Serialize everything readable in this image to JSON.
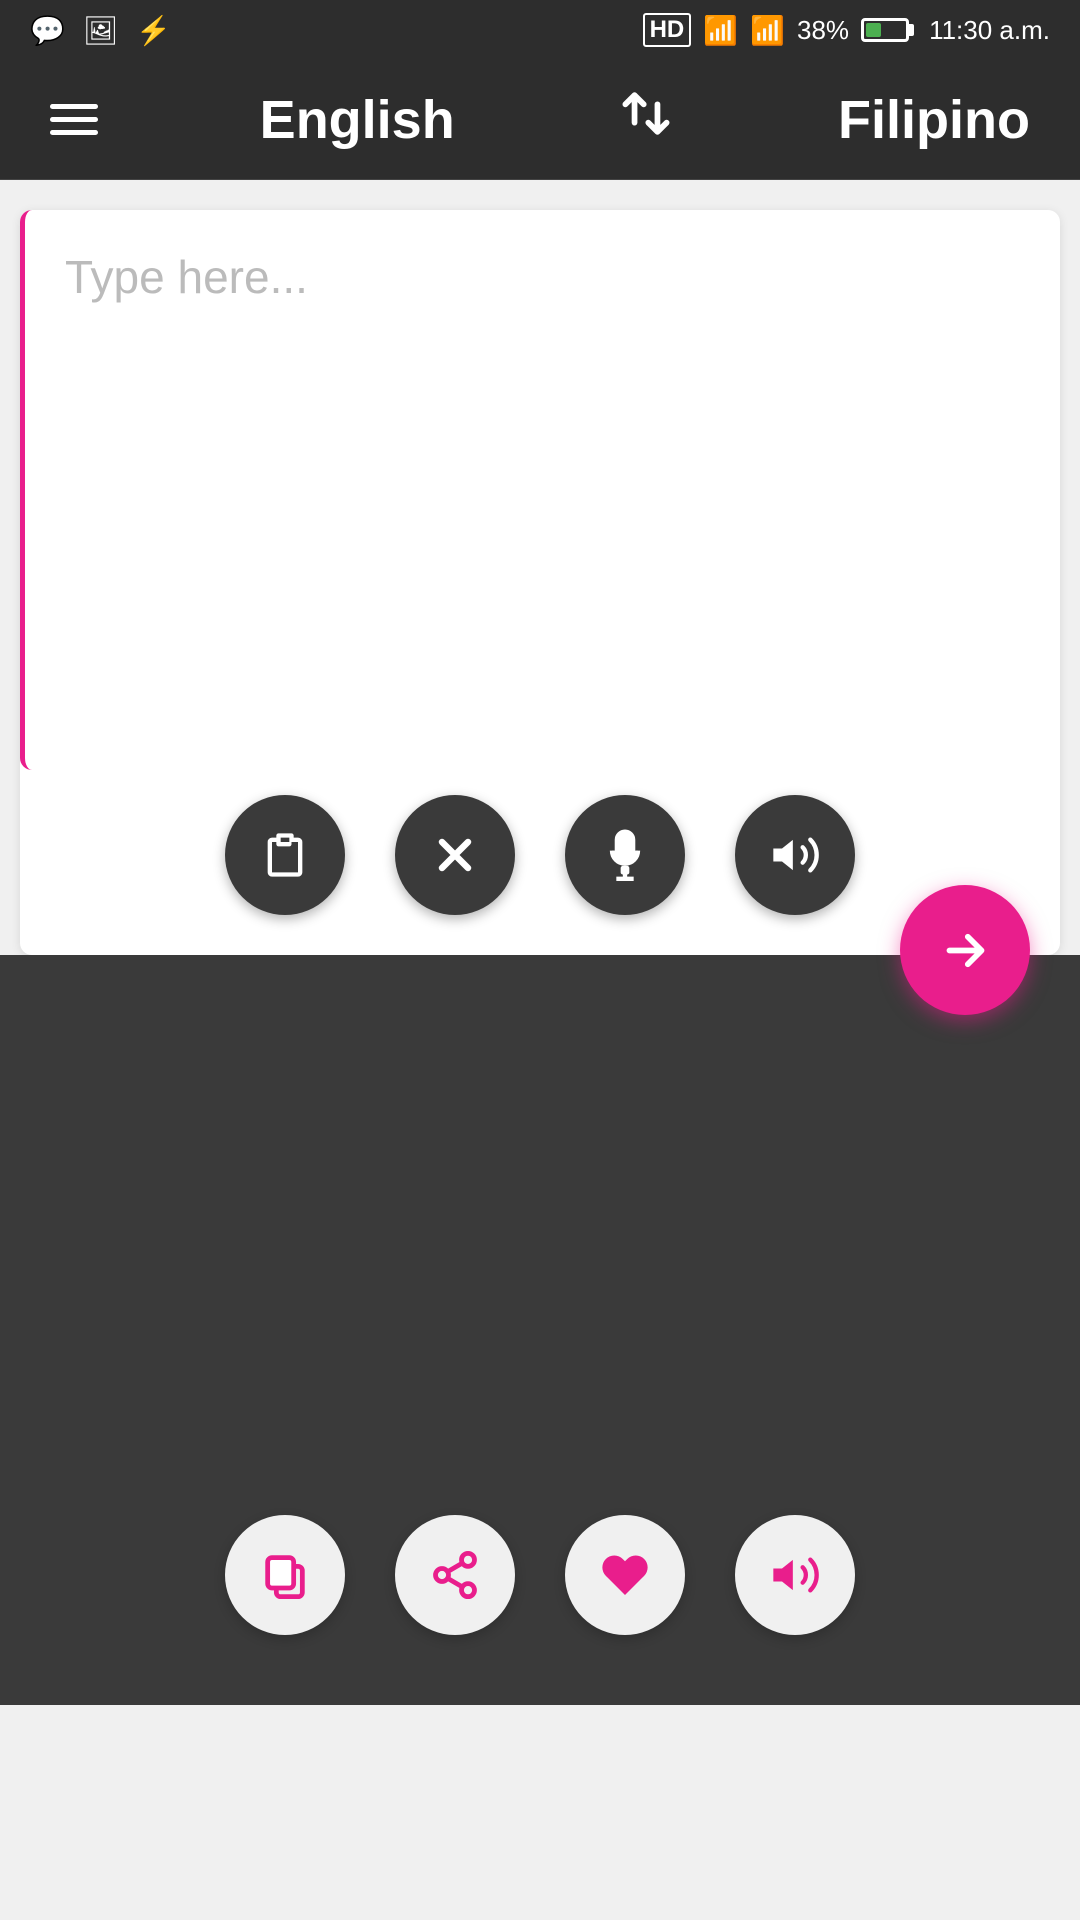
{
  "statusBar": {
    "time": "11:30 a.m.",
    "battery": "38%",
    "signal": "HD"
  },
  "toolbar": {
    "menuLabel": "Menu",
    "languageFrom": "English",
    "swapLabel": "Swap languages",
    "languageTo": "Filipino"
  },
  "inputArea": {
    "placeholder": "Type here...",
    "value": ""
  },
  "inputButtons": [
    {
      "name": "paste",
      "label": "Paste"
    },
    {
      "name": "clear",
      "label": "Clear"
    },
    {
      "name": "microphone",
      "label": "Microphone"
    },
    {
      "name": "speak-input",
      "label": "Speak"
    }
  ],
  "sendButton": {
    "label": "Translate"
  },
  "outputArea": {
    "text": ""
  },
  "outputButtons": [
    {
      "name": "copy-output",
      "label": "Copy"
    },
    {
      "name": "share-output",
      "label": "Share"
    },
    {
      "name": "favorite-output",
      "label": "Favorite"
    },
    {
      "name": "speak-output",
      "label": "Speak"
    }
  ]
}
